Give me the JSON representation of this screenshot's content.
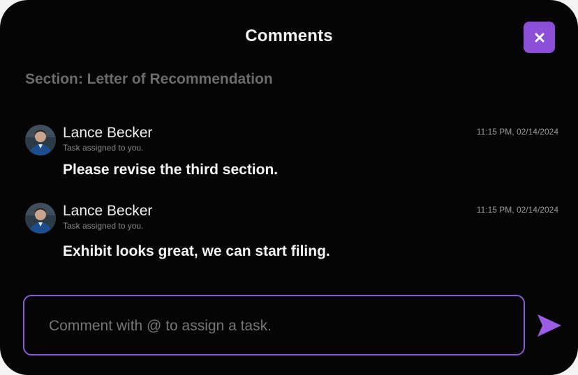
{
  "header": {
    "title": "Comments"
  },
  "section": {
    "label": "Section: Letter of Recommendation"
  },
  "comments": [
    {
      "author": "Lance Becker",
      "subtext": "Task assigned to you.",
      "timestamp": "11:15 PM, 02/14/2024",
      "body": "Please revise the third section."
    },
    {
      "author": "Lance Becker",
      "subtext": "Task assigned to you.",
      "timestamp": "11:15 PM, 02/14/2024",
      "body": "Exhibit looks great, we can start filing."
    }
  ],
  "composer": {
    "placeholder": "Comment with @ to assign a task.",
    "value": ""
  },
  "icons": {
    "close": "close-icon",
    "send": "send-icon",
    "avatar": "user-avatar"
  },
  "colors": {
    "background": "#050505",
    "accent": "#8b4fd8",
    "muted_text": "#6c6c6c"
  }
}
